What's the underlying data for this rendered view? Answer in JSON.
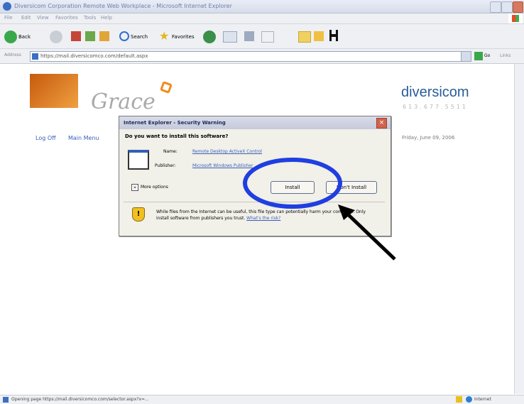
{
  "window": {
    "title": "Diversicom Corporation Remote Web Workplace - Microsoft Internet Explorer"
  },
  "menubar": [
    "File",
    "Edit",
    "View",
    "Favorites",
    "Tools",
    "Help"
  ],
  "toolbar": {
    "back_label": "Back",
    "search_label": "Search",
    "favorites_label": "Favorites"
  },
  "addressbar": {
    "label": "Address",
    "url": "https://mail.diversicomco.com/default.aspx",
    "go_label": "Go",
    "links_label": "Links"
  },
  "page": {
    "logo_text": "Grace",
    "brand_name": "diversicom",
    "phone": "613.677.5511",
    "logoff_label": "Log Off",
    "main_menu_label": "Main Menu",
    "date": "Friday, June 09, 2006"
  },
  "dialog": {
    "title": "Internet Explorer - Security Warning",
    "question": "Do you want to install this software?",
    "name_label": "Name:",
    "name_value": "Remote Desktop ActiveX Control",
    "publisher_label": "Publisher:",
    "publisher_value": "Microsoft Windows Publisher",
    "more_options": "More options",
    "install_label": "Install",
    "dont_install_label": "Don't Install",
    "warning_text": "While files from the Internet can be useful, this file type can potentially harm your computer. Only install software from publishers you trust.",
    "risk_link": "What's the risk?"
  },
  "statusbar": {
    "text": "Opening page https://mail.diversicomco.com/selector.aspx?x=...",
    "zone": "Internet"
  },
  "annotation": {
    "circle_color": "#1f3fe0",
    "arrow_color": "#000000"
  }
}
